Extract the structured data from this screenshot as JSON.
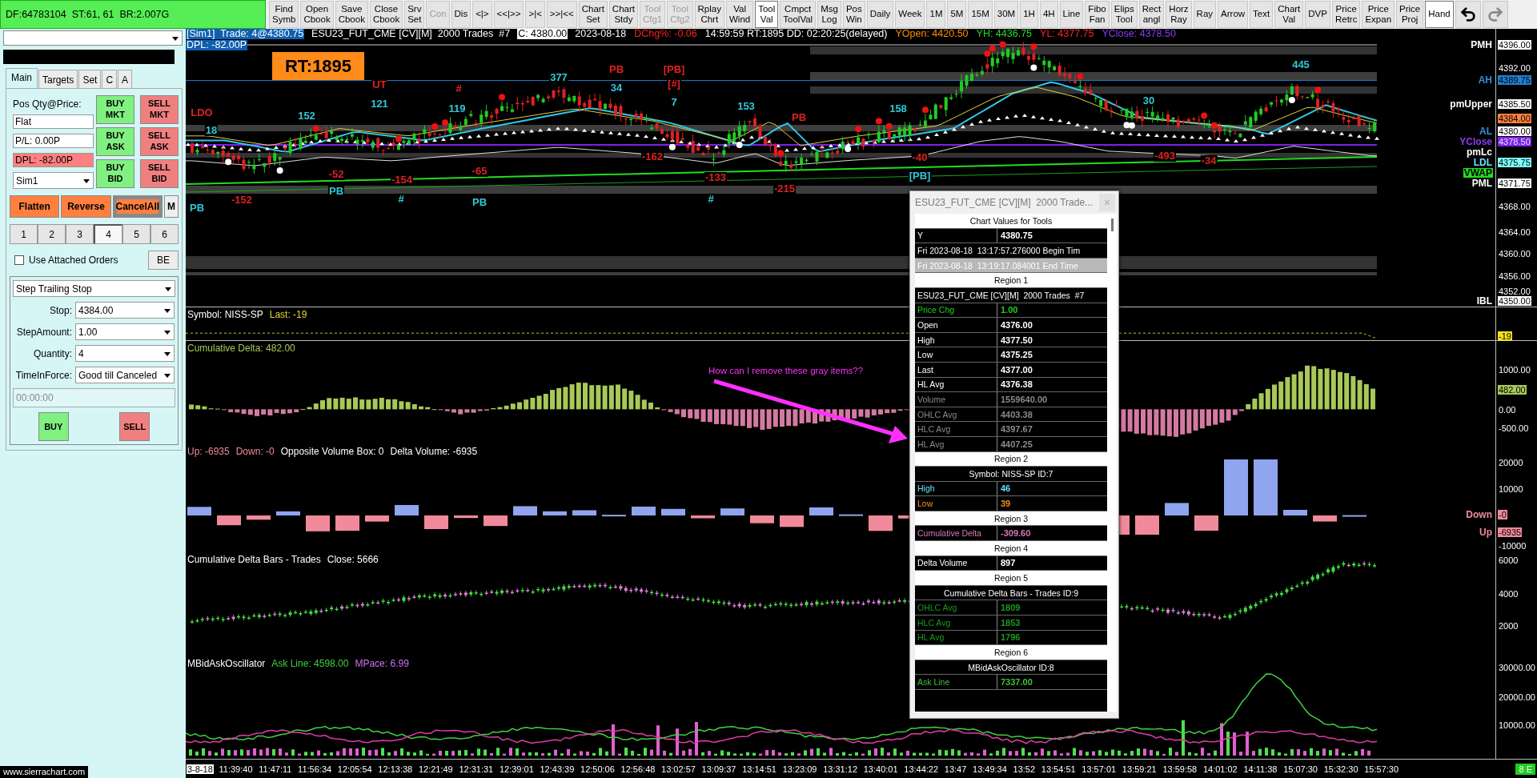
{
  "toolbar": {
    "status": "DF:64783104  ST:61, 61  BR:2.007G",
    "buttons": [
      {
        "lines": [
          "Find",
          "Symb"
        ],
        "selected": false,
        "disabled": false
      },
      {
        "lines": [
          "Open",
          "Cbook"
        ],
        "selected": false,
        "disabled": false
      },
      {
        "lines": [
          "Save",
          "Cbook"
        ],
        "selected": false,
        "disabled": false
      },
      {
        "lines": [
          "Close",
          "Cbook"
        ],
        "selected": false,
        "disabled": false
      },
      {
        "lines": [
          "Srv",
          "Set"
        ],
        "selected": false,
        "disabled": false
      },
      {
        "lines": [
          "Con"
        ],
        "selected": false,
        "disabled": true
      },
      {
        "lines": [
          "Dis"
        ],
        "selected": false,
        "disabled": false
      },
      {
        "lines": [
          "<|>"
        ],
        "selected": false,
        "disabled": false
      },
      {
        "lines": [
          "<<|>>"
        ],
        "selected": false,
        "disabled": false
      },
      {
        "lines": [
          ">|<"
        ],
        "selected": false,
        "disabled": false
      },
      {
        "lines": [
          ">>|<<"
        ],
        "selected": false,
        "disabled": false
      },
      {
        "lines": [
          "Chart",
          "Set"
        ],
        "selected": false,
        "disabled": false
      },
      {
        "lines": [
          "Chart",
          "Stdy"
        ],
        "selected": false,
        "disabled": false
      },
      {
        "lines": [
          "Tool",
          "Cfg1"
        ],
        "selected": false,
        "disabled": true
      },
      {
        "lines": [
          "Tool",
          "Cfg2"
        ],
        "selected": false,
        "disabled": true
      },
      {
        "lines": [
          "Rplay",
          "Chrt"
        ],
        "selected": false,
        "disabled": false
      },
      {
        "lines": [
          "Val",
          "Wind"
        ],
        "selected": false,
        "disabled": false
      },
      {
        "lines": [
          "Tool",
          "Val"
        ],
        "selected": true,
        "disabled": false
      },
      {
        "lines": [
          "Cmpct",
          "ToolVal"
        ],
        "selected": false,
        "disabled": false
      },
      {
        "lines": [
          "Msg",
          "Log"
        ],
        "selected": false,
        "disabled": false
      },
      {
        "lines": [
          "Pos",
          "Win"
        ],
        "selected": false,
        "disabled": false
      },
      {
        "lines": [
          "Daily"
        ],
        "selected": false,
        "disabled": false
      },
      {
        "lines": [
          "Week"
        ],
        "selected": false,
        "disabled": false
      },
      {
        "lines": [
          "1M"
        ],
        "selected": false,
        "disabled": false
      },
      {
        "lines": [
          "5M"
        ],
        "selected": false,
        "disabled": false
      },
      {
        "lines": [
          "15M"
        ],
        "selected": false,
        "disabled": false
      },
      {
        "lines": [
          "30M"
        ],
        "selected": false,
        "disabled": false
      },
      {
        "lines": [
          "1H"
        ],
        "selected": false,
        "disabled": false
      },
      {
        "lines": [
          "4H"
        ],
        "selected": false,
        "disabled": false
      },
      {
        "lines": [
          "Line"
        ],
        "selected": false,
        "disabled": false
      },
      {
        "lines": [
          "Fibo",
          "Fan"
        ],
        "selected": false,
        "disabled": false
      },
      {
        "lines": [
          "Elips",
          "Tool"
        ],
        "selected": false,
        "disabled": false
      },
      {
        "lines": [
          "Rect",
          "angl"
        ],
        "selected": false,
        "disabled": false
      },
      {
        "lines": [
          "Horz",
          "Ray"
        ],
        "selected": false,
        "disabled": false
      },
      {
        "lines": [
          "Ray"
        ],
        "selected": false,
        "disabled": false
      },
      {
        "lines": [
          "Arrow"
        ],
        "selected": false,
        "disabled": false
      },
      {
        "lines": [
          "Text"
        ],
        "selected": false,
        "disabled": false
      },
      {
        "lines": [
          "Chart",
          "Val"
        ],
        "selected": false,
        "disabled": false
      },
      {
        "lines": [
          "DVP"
        ],
        "selected": false,
        "disabled": false
      },
      {
        "lines": [
          "Price",
          "Retrc"
        ],
        "selected": false,
        "disabled": false
      },
      {
        "lines": [
          "Price",
          "Expan"
        ],
        "selected": false,
        "disabled": false
      },
      {
        "lines": [
          "Price",
          "Proj"
        ],
        "selected": false,
        "disabled": false
      },
      {
        "lines": [
          "Hand"
        ],
        "selected": true,
        "disabled": false
      }
    ],
    "history": [
      {
        "kind": "undo",
        "disabled": false
      },
      {
        "kind": "redo",
        "disabled": true
      }
    ]
  },
  "order_panel": {
    "tabs": [
      {
        "label": "Main",
        "selected": true
      },
      {
        "label": "Targets",
        "selected": false
      },
      {
        "label": "Set",
        "selected": false
      },
      {
        "label": "C",
        "selected": false
      },
      {
        "label": "A",
        "selected": false
      }
    ],
    "position_label": "Pos Qty@Price:",
    "fields": [
      {
        "value": "Flat",
        "alert": false
      },
      {
        "value": "P/L: 0.00P",
        "alert": false
      },
      {
        "value": "DPL: -82.00P",
        "alert": true
      }
    ],
    "account": "Sim1",
    "trade_buttons": [
      {
        "lines": [
          "BUY",
          "MKT"
        ],
        "color": "#80f080"
      },
      {
        "lines": [
          "SELL",
          "MKT"
        ],
        "color": "#f08080"
      },
      {
        "lines": [
          "BUY",
          "ASK"
        ],
        "color": "#80f080"
      },
      {
        "lines": [
          "SELL",
          "ASK"
        ],
        "color": "#f08080"
      },
      {
        "lines": [
          "BUY",
          "BID"
        ],
        "color": "#80f080"
      },
      {
        "lines": [
          "SELL",
          "BID"
        ],
        "color": "#f08080"
      }
    ],
    "action_buttons": [
      {
        "label": "Flatten",
        "kind": "orange"
      },
      {
        "label": "Reverse",
        "kind": "orange"
      },
      {
        "label": "CancelAll",
        "kind": "cancel"
      },
      {
        "label": "M",
        "kind": "plain"
      }
    ],
    "quantity_buttons": [
      {
        "label": "1",
        "selected": false
      },
      {
        "label": "2",
        "selected": false
      },
      {
        "label": "3",
        "selected": false
      },
      {
        "label": "4",
        "selected": true
      },
      {
        "label": "5",
        "selected": false
      },
      {
        "label": "6",
        "selected": false
      }
    ],
    "attached_orders": {
      "label": "Use Attached Orders",
      "checked": false
    },
    "be_button": "BE",
    "order_type": "Step Trailing Stop",
    "params": [
      {
        "label": "Stop:",
        "value": "4384.00"
      },
      {
        "label": "StepAmount:",
        "value": "1.00"
      },
      {
        "label": "Quantity:",
        "value": "4"
      },
      {
        "label": "TimeInForce:",
        "value": "Good till Canceled"
      }
    ],
    "time_field": {
      "placeholder": "00:00:00"
    },
    "order_buttons": [
      {
        "label": "BUY",
        "color": "#80f080"
      },
      {
        "label": "SELL",
        "color": "#f08080"
      }
    ],
    "footer": "www.sierrachart.com"
  },
  "chart": {
    "header": [
      [
        {
          "text": "[Sim1]  Trade: 4@4380.75",
          "kind": "highlight",
          "color": "#0f5fb0"
        },
        {
          "text": "ESU23_FUT_CME [CV][M]  2000 Trades  #7",
          "kind": "plain",
          "color": "#ffffff"
        },
        {
          "text": "C: 4380.00",
          "kind": "boxed",
          "color": "#ffffff"
        },
        {
          "text": "2023-08-18",
          "kind": "plain",
          "color": "#ffffff"
        },
        {
          "text": "DChg%: -0.06",
          "kind": "plain",
          "color": "#ff2020"
        },
        {
          "text": "14:59:59 RT:1895 DD: 02:20:25(delayed)",
          "kind": "plain",
          "color": "#ffffff"
        },
        {
          "text": "YOpen: 4420.50",
          "kind": "plain",
          "color": "#ff8c00"
        },
        {
          "text": "YH: 4436.75",
          "kind": "plain",
          "color": "#22dd22"
        },
        {
          "text": "YL: 4377.75",
          "kind": "plain",
          "color": "#ff2020"
        },
        {
          "text": "YClose: 4378.50",
          "kind": "plain",
          "color": "#8a3cf0"
        }
      ],
      [
        {
          "text": "DPL: -82.00P",
          "kind": "highlight",
          "color": "#0f5fb0"
        }
      ]
    ],
    "rt_badge": "RT:1895",
    "labels": [
      {
        "text": "PB",
        "color": "#e02020"
      },
      {
        "text": "[PB]",
        "color": "#e02020"
      },
      {
        "text": "445",
        "color": "#30c8d8"
      },
      {
        "text": "377",
        "color": "#30c8d8"
      },
      {
        "text": "UT",
        "color": "#e02020"
      },
      {
        "text": "#",
        "color": "#e02020"
      },
      {
        "text": "34",
        "color": "#30c8d8"
      },
      {
        "text": "[#]",
        "color": "#e02020"
      },
      {
        "text": "121",
        "color": "#30c8d8"
      },
      {
        "text": "119",
        "color": "#30c8d8"
      },
      {
        "text": "7",
        "color": "#30c8d8"
      },
      {
        "text": "153",
        "color": "#30c8d8"
      },
      {
        "text": "158",
        "color": "#30c8d8"
      },
      {
        "text": "30",
        "color": "#30c8d8"
      },
      {
        "text": "LDO",
        "color": "#e02020"
      },
      {
        "text": "152",
        "color": "#30c8d8"
      },
      {
        "text": "PB",
        "color": "#e02020"
      },
      {
        "text": "18",
        "color": "#30c8d8"
      },
      {
        "text": "-162",
        "color": "#e02020"
      },
      {
        "text": "-40",
        "color": "#e02020"
      },
      {
        "text": "-493",
        "color": "#e02020"
      },
      {
        "text": "-34",
        "color": "#e02020"
      },
      {
        "text": "-52",
        "color": "#e02020"
      },
      {
        "text": "-154",
        "color": "#e02020"
      },
      {
        "text": "-65",
        "color": "#e02020"
      },
      {
        "text": "-133",
        "color": "#e02020"
      },
      {
        "text": "[PB]",
        "color": "#30c8d8"
      },
      {
        "text": "PB",
        "color": "#30c8d8"
      },
      {
        "text": "-215",
        "color": "#e02020"
      },
      {
        "text": "-152",
        "color": "#e02020"
      },
      {
        "text": "#",
        "color": "#30c8d8"
      },
      {
        "text": "PB",
        "color": "#30c8d8"
      },
      {
        "text": "#",
        "color": "#30c8d8"
      },
      {
        "text": "PB",
        "color": "#30c8d8"
      }
    ],
    "price_axis": [
      {
        "kind": "level",
        "name": {
          "text": "PMH",
          "color": "#ffffff"
        },
        "value": {
          "text": "4396.00",
          "color": "#ffffff"
        }
      },
      {
        "kind": "tick",
        "value": {
          "text": "4392.00"
        }
      },
      {
        "kind": "level",
        "name": {
          "text": "AH",
          "color": "#2f8fe0"
        },
        "value": {
          "text": "4389.75",
          "color": "#1f7fd0"
        }
      },
      {
        "kind": "level",
        "name": {
          "text": "pmUpper",
          "color": "#ffffff"
        },
        "value": {
          "text": "4385.50",
          "color": "#ffffff"
        }
      },
      {
        "kind": "level",
        "value": {
          "text": "4384.00",
          "color": "#ff7f3f"
        }
      },
      {
        "kind": "level",
        "name": {
          "text": "AL",
          "color": "#2f8fe0"
        },
        "value": {
          "text": "4380.00",
          "color": "#ffffff"
        }
      },
      {
        "kind": "level",
        "name": {
          "text": "YClose",
          "color": "#8a3cf0"
        },
        "value": {
          "text": "4378.50",
          "color": "#7a22e8"
        }
      },
      {
        "kind": "name",
        "name": {
          "text": "pmLc",
          "color": "#ffffff"
        }
      },
      {
        "kind": "level",
        "name": {
          "text": "LDL",
          "color": "#66e0ff"
        },
        "value": {
          "text": "4375.75",
          "color": "#80ffff"
        }
      },
      {
        "kind": "name-box",
        "name": {
          "text": "VWAP",
          "color": "#22dd22"
        }
      },
      {
        "kind": "level",
        "name": {
          "text": "PML",
          "color": "#ffffff"
        },
        "value": {
          "text": "4371.75",
          "color": "#ffffff"
        }
      },
      {
        "kind": "tick",
        "value": {
          "text": "4368.00"
        }
      },
      {
        "kind": "tick",
        "value": {
          "text": "4364.00"
        }
      },
      {
        "kind": "tick",
        "value": {
          "text": "4360.00"
        }
      },
      {
        "kind": "tick",
        "value": {
          "text": "4356.00"
        }
      },
      {
        "kind": "tick",
        "value": {
          "text": "4352.00"
        }
      },
      {
        "kind": "level",
        "name": {
          "text": "IBL",
          "color": "#ffffff"
        },
        "value": {
          "text": "4350.00",
          "color": "#ffffff"
        }
      }
    ],
    "regions": [
      {
        "kind": "line",
        "title": [
          {
            "text": "Symbol: NISS-SP",
            "color": "#ffffff"
          },
          {
            "text": "Last: -19",
            "color": "#e8d830"
          }
        ],
        "axis": [
          {
            "kind": "level",
            "value": {
              "text": "-19",
              "color": "#f0e020"
            }
          }
        ]
      },
      {
        "kind": "histogram",
        "title": [
          {
            "text": "Cumulative Delta: 482.00",
            "color": "#a8c858"
          }
        ],
        "axis": [
          {
            "kind": "tick",
            "value": {
              "text": "1000.00"
            }
          },
          {
            "kind": "level",
            "value": {
              "text": "482.00",
              "color": "#a8c858"
            }
          },
          {
            "kind": "tick",
            "value": {
              "text": "0.00"
            }
          },
          {
            "kind": "tick",
            "value": {
              "text": "-500.00"
            }
          }
        ]
      },
      {
        "kind": "volume",
        "title": [
          {
            "text": "Up: -6935",
            "color": "#f08a9a"
          },
          {
            "text": "Down: -0",
            "color": "#f08a9a"
          },
          {
            "text": "Opposite Volume Box: 0",
            "color": "#ffffff"
          },
          {
            "text": "Delta Volume: -6935",
            "color": "#ffffff"
          }
        ],
        "axis": [
          {
            "kind": "tick",
            "value": {
              "text": "20000"
            }
          },
          {
            "kind": "tick",
            "value": {
              "text": "10000"
            }
          },
          {
            "kind": "level",
            "name": {
              "text": "Down",
              "color": "#f08a9a"
            },
            "value": {
              "text": "-0",
              "color": "#f08a9a"
            }
          },
          {
            "kind": "level",
            "name": {
              "text": "Up",
              "color": "#f08a9a"
            },
            "value": {
              "text": "-6935",
              "color": "#f08a9a"
            }
          },
          {
            "kind": "tick",
            "value": {
              "text": "-10000"
            }
          }
        ]
      },
      {
        "kind": "candles",
        "title": [
          {
            "text": "Cumulative Delta Bars - Trades",
            "color": "#ffffff"
          },
          {
            "text": "Close: 5666",
            "color": "#ffffff"
          }
        ],
        "axis": [
          {
            "kind": "tick",
            "value": {
              "text": "6000"
            }
          },
          {
            "kind": "tick",
            "value": {
              "text": "4000"
            }
          },
          {
            "kind": "tick",
            "value": {
              "text": "2000"
            }
          }
        ]
      },
      {
        "kind": "oscillator",
        "title": [
          {
            "text": "MBidAskOscillator",
            "color": "#ffffff"
          },
          {
            "text": "Ask Line: 4598.00",
            "color": "#40d040"
          },
          {
            "text": "MPace: 6.99",
            "color": "#d070f0"
          }
        ],
        "axis": [
          {
            "kind": "tick",
            "value": {
              "text": "30000.00"
            }
          },
          {
            "kind": "tick",
            "value": {
              "text": "20000.00"
            }
          },
          {
            "kind": "tick",
            "value": {
              "text": "10000.00"
            }
          }
        ]
      }
    ]
  },
  "time_axis": {
    "labels": [
      {
        "text": "3-8-18",
        "highlighted": true
      },
      {
        "text": "11:39:40",
        "highlighted": false
      },
      {
        "text": "11:47:11",
        "highlighted": false
      },
      {
        "text": "11:56:34",
        "highlighted": false
      },
      {
        "text": "12:05:54",
        "highlighted": false
      },
      {
        "text": "12:13:38",
        "highlighted": false
      },
      {
        "text": "12:21:49",
        "highlighted": false
      },
      {
        "text": "12:31:31",
        "highlighted": false
      },
      {
        "text": "12:39:01",
        "highlighted": false
      },
      {
        "text": "12:43:39",
        "highlighted": false
      },
      {
        "text": "12:50:06",
        "highlighted": false
      },
      {
        "text": "12:56:48",
        "highlighted": false
      },
      {
        "text": "13:02:57",
        "highlighted": false
      },
      {
        "text": "13:09:37",
        "highlighted": false
      },
      {
        "text": "13:14:51",
        "highlighted": false
      },
      {
        "text": "13:23:09",
        "highlighted": false
      },
      {
        "text": "13:31:12",
        "highlighted": false
      },
      {
        "text": "13:40:01",
        "highlighted": false
      },
      {
        "text": "13:44:22",
        "highlighted": false
      },
      {
        "text": "13:47",
        "highlighted": false
      },
      {
        "text": "13:49:34",
        "highlighted": false
      },
      {
        "text": "13:52",
        "highlighted": false
      },
      {
        "text": "13:54:51",
        "highlighted": false
      },
      {
        "text": "13:57:01",
        "highlighted": false
      },
      {
        "text": "13:59:21",
        "highlighted": false
      },
      {
        "text": "13:59:58",
        "highlighted": false
      },
      {
        "text": "14:01:02",
        "highlighted": false
      },
      {
        "text": "14:11:38",
        "highlighted": false
      },
      {
        "text": "15:07:30",
        "highlighted": false
      },
      {
        "text": "15:32:30",
        "highlighted": false
      },
      {
        "text": "15:57:30",
        "highlighted": false
      }
    ],
    "badge": "8 E"
  },
  "values_window": {
    "title": "ESU23_FUT_CME [CV][M]  2000 Trade...",
    "close": "×",
    "rows": [
      {
        "kind": "header",
        "text": "Chart Values for Tools"
      },
      {
        "kind": "pair",
        "label": "Y",
        "value": "4380.75",
        "color": "#ffffff"
      },
      {
        "kind": "line",
        "text": "Fri 2023-08-18  13:17:57.276000 Begin Tim"
      },
      {
        "kind": "gray",
        "text": "Fri 2023-08-18  13:19:17.084001 End Time"
      },
      {
        "kind": "header",
        "text": "Region 1"
      },
      {
        "kind": "line",
        "text": "ESU23_FUT_CME [CV][M]  2000 Trades  #7"
      },
      {
        "kind": "pair",
        "label": "Price Chg",
        "value": "1.00",
        "color": "#22cc22"
      },
      {
        "kind": "pair",
        "label": "Open",
        "value": "4376.00",
        "color": "#ffffff"
      },
      {
        "kind": "pair",
        "label": "High",
        "value": "4377.50",
        "color": "#ffffff"
      },
      {
        "kind": "pair",
        "label": "Low",
        "value": "4375.25",
        "color": "#ffffff"
      },
      {
        "kind": "pair",
        "label": "Last",
        "value": "4377.00",
        "color": "#ffffff"
      },
      {
        "kind": "pair",
        "label": "HL Avg",
        "value": "4376.38",
        "color": "#ffffff"
      },
      {
        "kind": "pair",
        "label": "Volume",
        "value": "1559640.00",
        "color": "#8a8a8a"
      },
      {
        "kind": "pair",
        "label": "OHLC Avg",
        "value": "4403.38",
        "color": "#8a8a8a"
      },
      {
        "kind": "pair",
        "label": "HLC Avg",
        "value": "4397.67",
        "color": "#8a8a8a"
      },
      {
        "kind": "pair",
        "label": "HL Avg",
        "value": "4407.25",
        "color": "#8a8a8a"
      },
      {
        "kind": "header",
        "text": "Region 2"
      },
      {
        "kind": "title",
        "text": "Symbol: NISS-SP ID:7"
      },
      {
        "kind": "pair",
        "label": "High",
        "value": "46",
        "color": "#66e0ff"
      },
      {
        "kind": "pair",
        "label": "Low",
        "value": "39",
        "color": "#ff8c1a"
      },
      {
        "kind": "header",
        "text": "Region 3"
      },
      {
        "kind": "pair",
        "label": "Cumulative Delta",
        "value": "-309.60",
        "color": "#d878b8"
      },
      {
        "kind": "header",
        "text": "Region 4"
      },
      {
        "kind": "pair",
        "label": "Delta Volume",
        "value": "897",
        "color": "#ffffff"
      },
      {
        "kind": "header",
        "text": "Region 5"
      },
      {
        "kind": "title",
        "text": "Cumulative Delta Bars - Trades ID:9"
      },
      {
        "kind": "pair",
        "label": "OHLC Avg",
        "value": "1809",
        "color": "#1a9a1a"
      },
      {
        "kind": "pair",
        "label": "HLC Avg",
        "value": "1853",
        "color": "#1a9a1a"
      },
      {
        "kind": "pair",
        "label": "HL Avg",
        "value": "1796",
        "color": "#1a9a1a"
      },
      {
        "kind": "header",
        "text": "Region 6"
      },
      {
        "kind": "title",
        "text": "MBidAskOscillator ID:8"
      },
      {
        "kind": "pair",
        "label": "Ask Line",
        "value": "7337.00",
        "color": "#40c040"
      }
    ]
  },
  "annotation": {
    "text": "How can I remove these gray items??"
  }
}
